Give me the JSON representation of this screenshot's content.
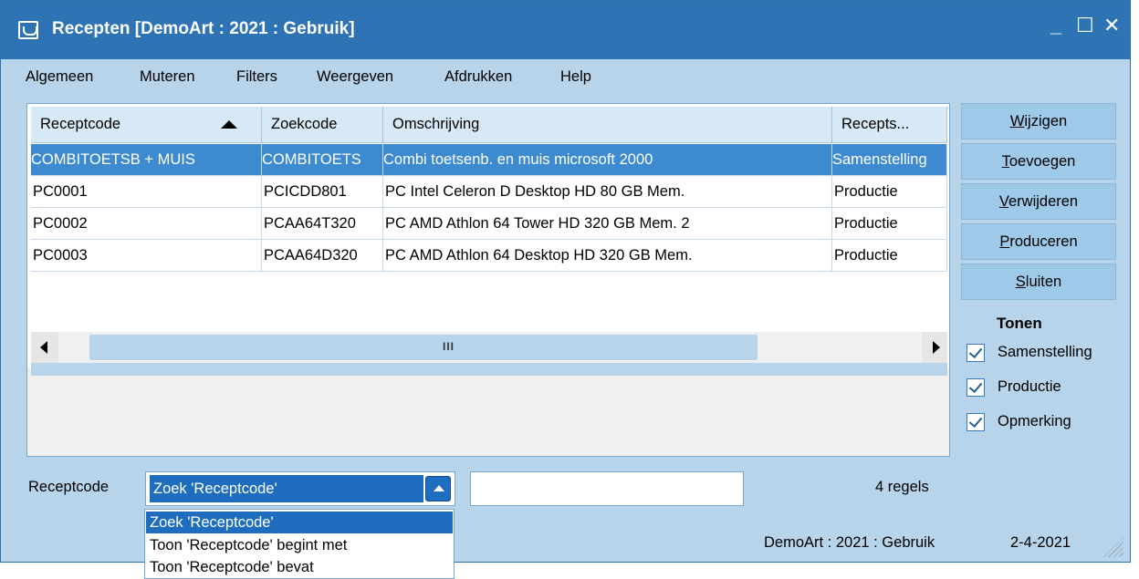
{
  "window": {
    "title": "Recepten  [DemoArt : 2021 : Gebruik]",
    "controls": [
      "_",
      "☐",
      "✕"
    ]
  },
  "menu": [
    "Algemeen",
    "Muteren",
    "Filters",
    "Weergeven",
    "Afdrukken",
    "Help"
  ],
  "table": {
    "columns": [
      "Receptcode",
      "Zoekcode",
      "Omschrijving",
      "Recepts..."
    ],
    "sort_indicator": "ascending",
    "rows": [
      {
        "code": "COMBITOETSB + MUIS",
        "zoek": "COMBITOETS",
        "omschrijving": "Combi toetsenb. en muis microsoft 2000",
        "soort": "Samenstelling",
        "selected": true
      },
      {
        "code": "PC0001",
        "zoek": "PCICDD801",
        "omschrijving": "PC Intel Celeron D Desktop HD 80 GB Mem.",
        "soort": "Productie",
        "selected": false
      },
      {
        "code": "PC0002",
        "zoek": "PCAA64T320",
        "omschrijving": "PC AMD Athlon 64 Tower HD 320 GB Mem. 2",
        "soort": "Productie",
        "selected": false
      },
      {
        "code": "PC0003",
        "zoek": "PCAA64D320",
        "omschrijving": "PC AMD Athlon 64 Desktop HD 320 GB Mem.",
        "soort": "Productie",
        "selected": false
      }
    ],
    "scroll_grip": "III"
  },
  "buttons": [
    {
      "key": "W",
      "rest": "ijzigen"
    },
    {
      "key": "T",
      "rest": "oevoegen"
    },
    {
      "key": "V",
      "rest": "erwijderen"
    },
    {
      "key": "P",
      "rest": "roduceren"
    },
    {
      "key": "S",
      "rest": "luiten"
    }
  ],
  "tonen": {
    "title": "Tonen",
    "options": [
      {
        "label": "Samenstelling",
        "checked": true
      },
      {
        "label": "Productie",
        "checked": true
      },
      {
        "label": "Opmerking",
        "checked": true
      }
    ]
  },
  "search": {
    "label": "Receptcode",
    "selected": "Zoek 'Receptcode'",
    "value": "",
    "options": [
      "Zoek 'Receptcode'",
      "Toon 'Receptcode' begint met",
      "Toon 'Receptcode' bevat"
    ]
  },
  "count": "4 regels",
  "status": {
    "context": "DemoArt : 2021 : Gebruik",
    "date": "2-4-2021"
  },
  "colors": {
    "titlebar": "#2e74b5",
    "panel": "#b7d4ea",
    "selection": "#3d8ad0"
  }
}
